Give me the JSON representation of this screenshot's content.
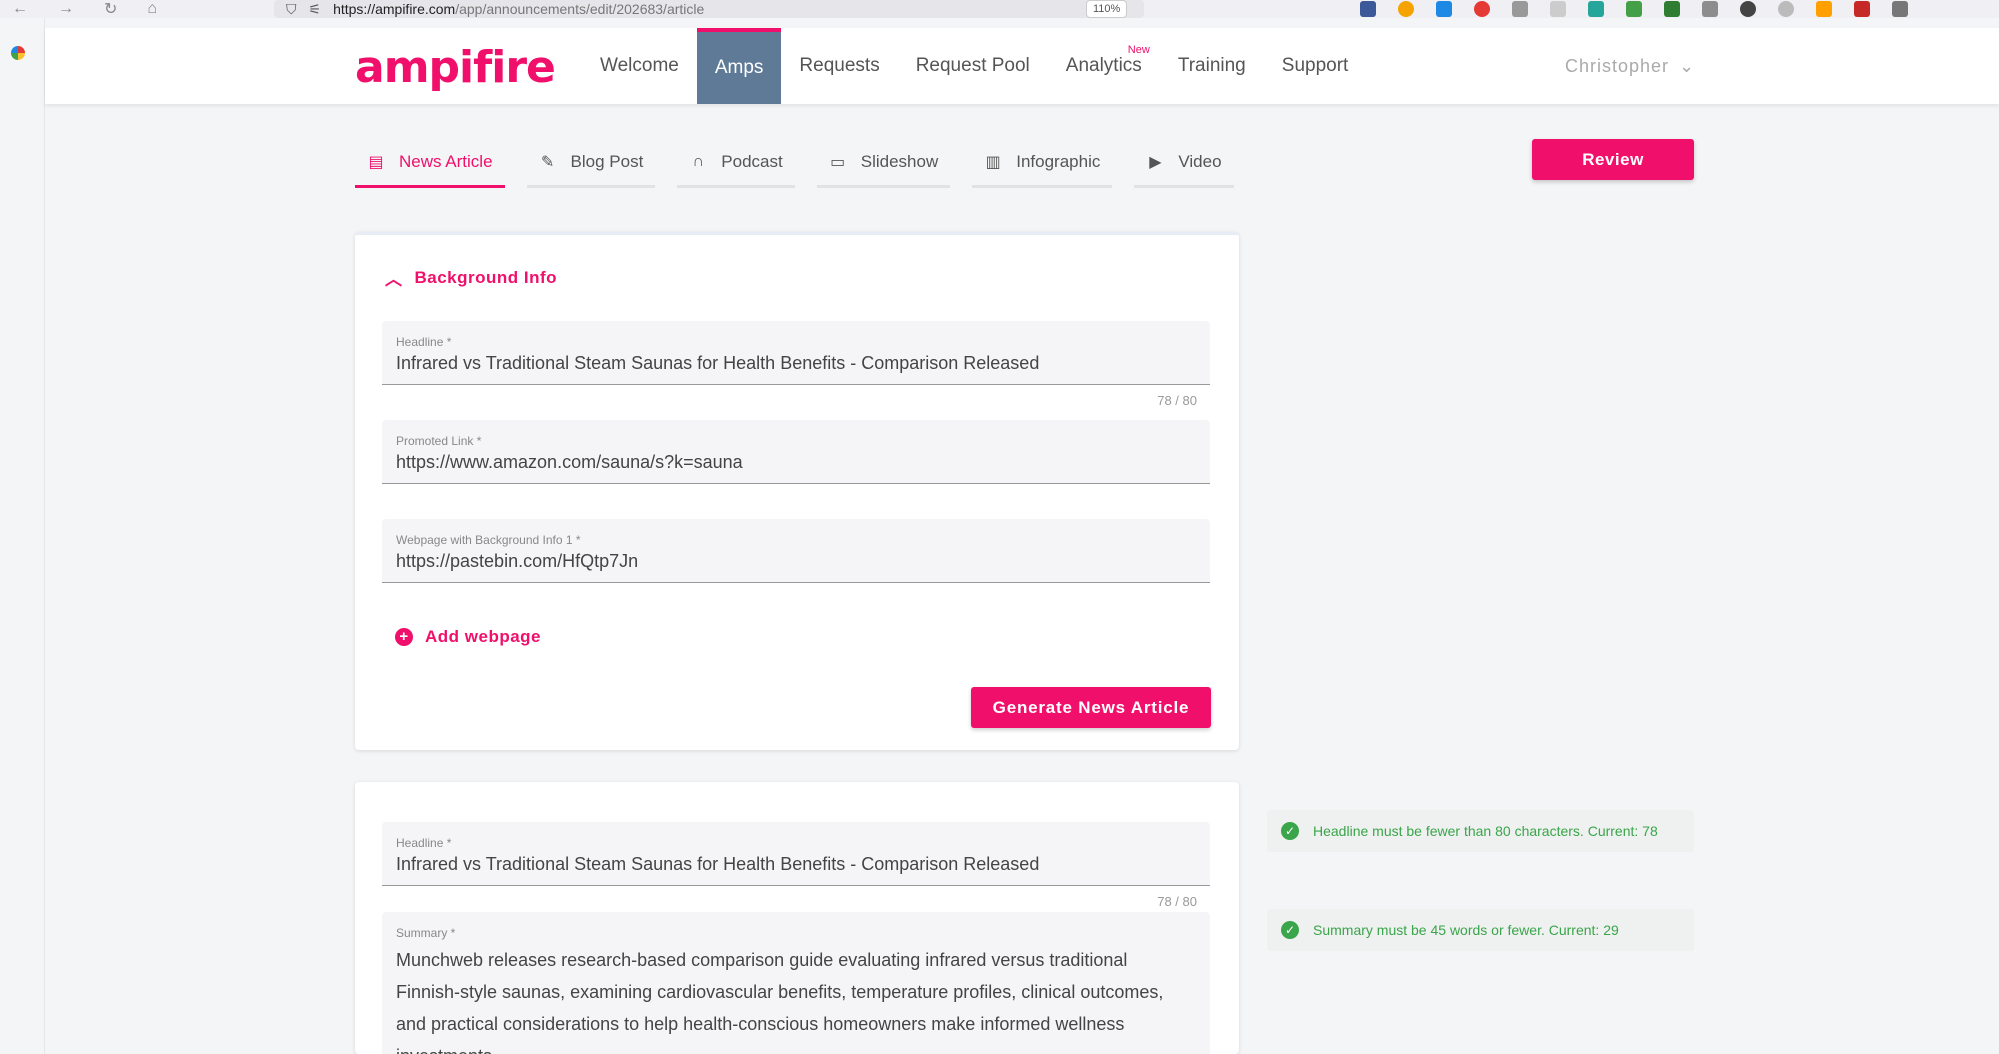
{
  "browser": {
    "url_domain": "https://ampifire.com",
    "url_path": "/app/announcements/edit/202683/article",
    "zoom": "110%"
  },
  "header": {
    "logo": "ampifire",
    "nav": [
      {
        "label": "Welcome"
      },
      {
        "label": "Amps"
      },
      {
        "label": "Requests"
      },
      {
        "label": "Request Pool"
      },
      {
        "label": "Analytics",
        "badge": "New"
      },
      {
        "label": "Training"
      },
      {
        "label": "Support"
      }
    ],
    "user": "Christopher"
  },
  "content_tabs": [
    {
      "label": "News Article",
      "icon": "document-icon"
    },
    {
      "label": "Blog Post",
      "icon": "edit-icon"
    },
    {
      "label": "Podcast",
      "icon": "headphones-icon"
    },
    {
      "label": "Slideshow",
      "icon": "monitor-icon"
    },
    {
      "label": "Infographic",
      "icon": "file-chart-icon"
    },
    {
      "label": "Video",
      "icon": "play-icon"
    }
  ],
  "review_button": "Review",
  "background_card": {
    "toggle_label": "Background Info",
    "headline_label": "Headline *",
    "headline_value": "Infrared vs Traditional Steam Saunas for Health Benefits - Comparison Released",
    "headline_counter": "78 / 80",
    "promoted_link_label": "Promoted Link *",
    "promoted_link_value": "https://www.amazon.com/sauna/s?k=sauna",
    "webpage_label": "Webpage with Background Info 1 *",
    "webpage_value": "https://pastebin.com/HfQtp7Jn",
    "add_webpage": "Add webpage",
    "generate_button": "Generate News Article"
  },
  "article_card": {
    "headline_label": "Headline *",
    "headline_value": "Infrared vs Traditional Steam Saunas for Health Benefits - Comparison Released",
    "headline_counter": "78 / 80",
    "summary_label": "Summary *",
    "summary_value": "Munchweb releases research-based comparison guide evaluating infrared versus traditional Finnish-style saunas, examining cardiovascular benefits, temperature profiles, clinical outcomes, and practical considerations to help health-conscious homeowners make informed wellness investments."
  },
  "validations": [
    {
      "text": "Headline must be fewer than 80 characters. Current: 78"
    },
    {
      "text": "Summary must be 45 words or fewer. Current: 29"
    }
  ],
  "colors": {
    "brand": "#f0106b",
    "active_nav": "#5e7a96",
    "success": "#3aa54a"
  }
}
